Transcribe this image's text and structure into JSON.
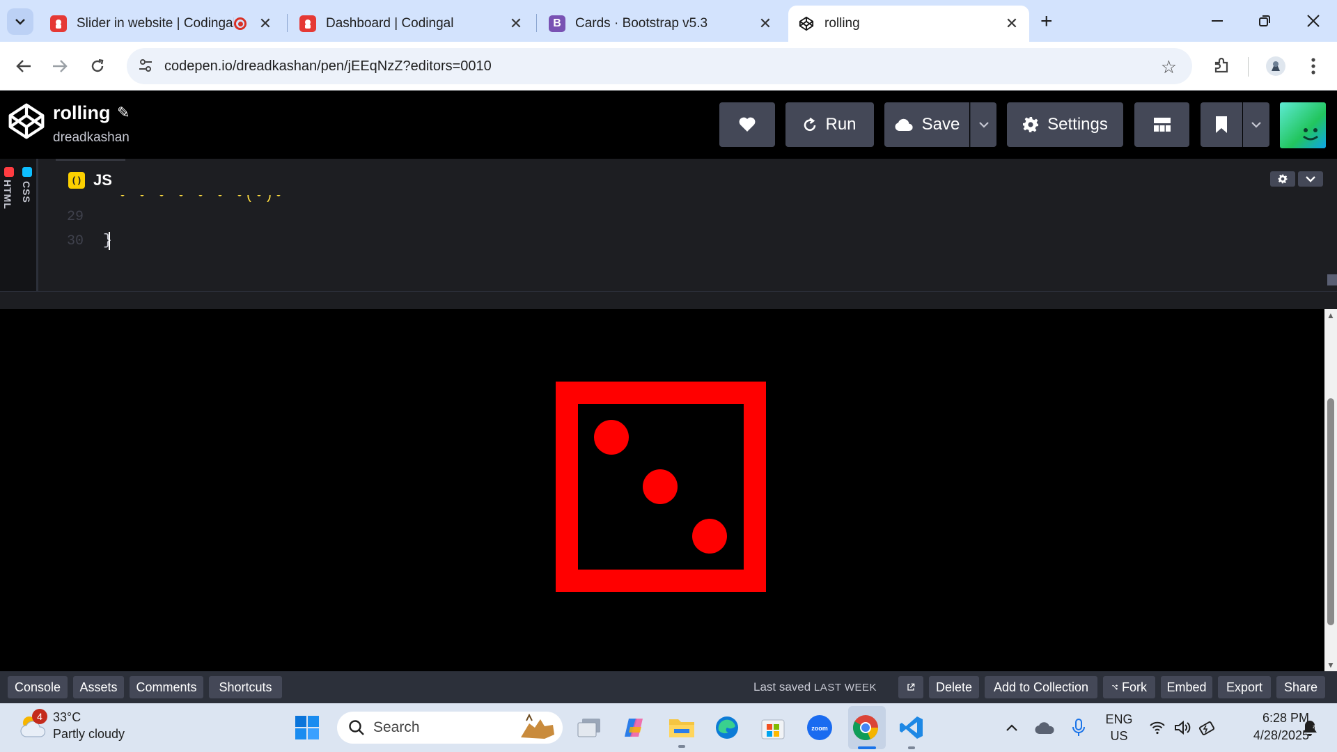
{
  "browser": {
    "tabs": [
      {
        "title": "Slider in website | Codingal"
      },
      {
        "title": "Dashboard | Codingal"
      },
      {
        "title": "Cards · Bootstrap v5.3"
      },
      {
        "title": "rolling"
      }
    ],
    "url": "codepen.io/dreadkashan/pen/jEEqNzZ?editors=0010"
  },
  "codepen": {
    "pen_title": "rolling",
    "author": "dreadkashan",
    "buttons": {
      "run": "Run",
      "save": "Save",
      "settings": "Settings"
    },
    "side_tabs": {
      "html": "HTML",
      "css": "CSS"
    },
    "editor": {
      "tab": "JS",
      "lines": [
        {
          "num": "29",
          "text": ""
        },
        {
          "num": "30",
          "text": "}"
        }
      ]
    },
    "footer": {
      "console": "Console",
      "assets": "Assets",
      "comments": "Comments",
      "shortcuts": "Shortcuts",
      "last_saved_label": "Last saved",
      "last_saved_when": "LAST WEEK",
      "delete": "Delete",
      "add_to_collection": "Add to Collection",
      "fork": "Fork",
      "embed": "Embed",
      "export": "Export",
      "share": "Share"
    }
  },
  "preview": {
    "die_face_value": 3,
    "die_color": "#ff0000"
  },
  "taskbar": {
    "weather_temp": "33°C",
    "weather_desc": "Partly cloudy",
    "weather_badge": "4",
    "search_label": "Search",
    "lang_top": "ENG",
    "lang_bottom": "US",
    "time": "6:28 PM",
    "date": "4/28/2025"
  }
}
